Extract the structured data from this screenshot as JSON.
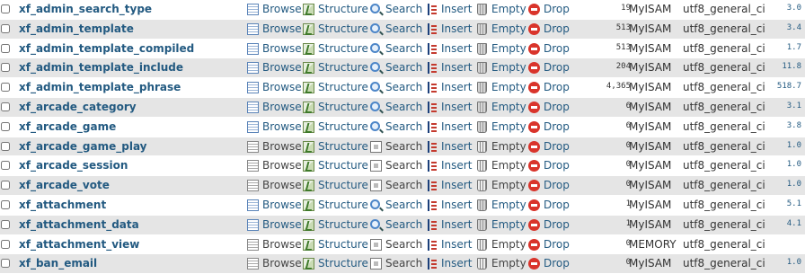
{
  "actions": {
    "browse": "Browse",
    "structure": "Structure",
    "search": "Search",
    "insert": "Insert",
    "empty": "Empty",
    "drop": "Drop"
  },
  "tables": [
    {
      "name": "xf_admin_search_type",
      "rows": "19",
      "engine": "MyISAM",
      "collation": "utf8_general_ci",
      "size": "3.0",
      "empty": false
    },
    {
      "name": "xf_admin_template",
      "rows": "513",
      "engine": "MyISAM",
      "collation": "utf8_general_ci",
      "size": "3.4",
      "empty": false
    },
    {
      "name": "xf_admin_template_compiled",
      "rows": "513",
      "engine": "MyISAM",
      "collation": "utf8_general_ci",
      "size": "1.7",
      "empty": false
    },
    {
      "name": "xf_admin_template_include",
      "rows": "204",
      "engine": "MyISAM",
      "collation": "utf8_general_ci",
      "size": "11.8",
      "empty": false
    },
    {
      "name": "xf_admin_template_phrase",
      "rows": "4,365",
      "engine": "MyISAM",
      "collation": "utf8_general_ci",
      "size": "518.7",
      "empty": false
    },
    {
      "name": "xf_arcade_category",
      "rows": "6",
      "engine": "MyISAM",
      "collation": "utf8_general_ci",
      "size": "3.1",
      "empty": false
    },
    {
      "name": "xf_arcade_game",
      "rows": "6",
      "engine": "MyISAM",
      "collation": "utf8_general_ci",
      "size": "3.8",
      "empty": false
    },
    {
      "name": "xf_arcade_game_play",
      "rows": "0",
      "engine": "MyISAM",
      "collation": "utf8_general_ci",
      "size": "1.0",
      "empty": true
    },
    {
      "name": "xf_arcade_session",
      "rows": "0",
      "engine": "MyISAM",
      "collation": "utf8_general_ci",
      "size": "1.0",
      "empty": true
    },
    {
      "name": "xf_arcade_vote",
      "rows": "0",
      "engine": "MyISAM",
      "collation": "utf8_general_ci",
      "size": "1.0",
      "empty": true
    },
    {
      "name": "xf_attachment",
      "rows": "1",
      "engine": "MyISAM",
      "collation": "utf8_general_ci",
      "size": "5.1",
      "empty": false
    },
    {
      "name": "xf_attachment_data",
      "rows": "1",
      "engine": "MyISAM",
      "collation": "utf8_general_ci",
      "size": "4.1",
      "empty": false
    },
    {
      "name": "xf_attachment_view",
      "rows": "0",
      "engine": "MEMORY",
      "collation": "utf8_general_ci",
      "size": "",
      "empty": true
    },
    {
      "name": "xf_ban_email",
      "rows": "0",
      "engine": "MyISAM",
      "collation": "utf8_general_ci",
      "size": "1.0",
      "empty": true
    }
  ]
}
